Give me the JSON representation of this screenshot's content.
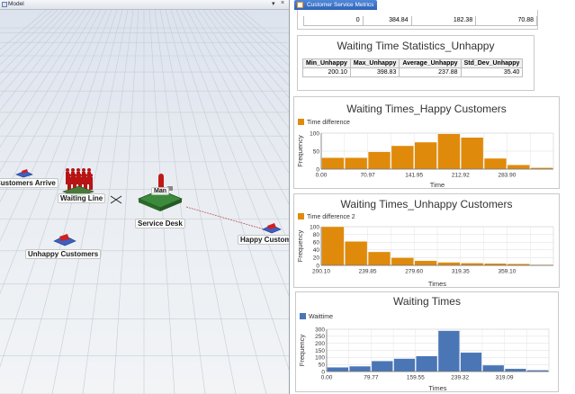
{
  "model_tab": {
    "label": "Model",
    "pin": "▾",
    "close": "×"
  },
  "model_objects": {
    "customers_arrive": "Customers Arrive",
    "waiting_line": "Waiting Line",
    "service_desk": "Service Desk",
    "happy_customers": "Happy Customers",
    "unhappy_customers": "Unhappy Customers",
    "man_label": "Man"
  },
  "metrics_tab": {
    "label": "Customer Service Metrics"
  },
  "top_partial_row": [
    "0",
    "384.84",
    "182.38",
    "70.88"
  ],
  "unhappy_stats": {
    "title": "Waiting Time Statistics_Unhappy",
    "headers": [
      "Min_Unhappy",
      "Max_Unhappy",
      "Average_Unhappy",
      "Std_Dev_Unhappy"
    ],
    "values": [
      "200.10",
      "398.83",
      "237.88",
      "35.40"
    ]
  },
  "chart_data": [
    {
      "type": "bar",
      "title": "Waiting Times_Happy Customers",
      "xlabel": "Time",
      "ylabel": "Frequency",
      "legend": "Time difference",
      "color": "#e08a0c",
      "ylim": [
        0,
        100
      ],
      "yticks": [
        0,
        50,
        100
      ],
      "x_tick_labels": [
        "0.00",
        "70.97",
        "141.95",
        "212.92",
        "283.90"
      ],
      "values": [
        32,
        32,
        48,
        65,
        75,
        98,
        88,
        30,
        12,
        4
      ]
    },
    {
      "type": "bar",
      "title": "Waiting Times_Unhappy Customers",
      "xlabel": "Times",
      "ylabel": "Frequency",
      "legend": "Time difference 2",
      "color": "#e08a0c",
      "ylim": [
        0,
        100
      ],
      "yticks": [
        0,
        20,
        40,
        60,
        80,
        100
      ],
      "x_tick_labels": [
        "200.10",
        "239.85",
        "279.60",
        "319.35",
        "359.10"
      ],
      "values": [
        100,
        62,
        35,
        20,
        12,
        8,
        6,
        5,
        4,
        2
      ]
    },
    {
      "type": "bar",
      "title": "Waiting Times",
      "xlabel": "Times",
      "ylabel": "Frequency",
      "legend": "Waittime",
      "color": "#4a76b6",
      "ylim": [
        0,
        300
      ],
      "yticks": [
        0,
        50,
        100,
        150,
        200,
        250,
        300
      ],
      "x_tick_labels": [
        "0.00",
        "79.77",
        "159.55",
        "239.32",
        "319.09"
      ],
      "values": [
        30,
        38,
        75,
        92,
        110,
        290,
        135,
        45,
        20,
        10
      ]
    }
  ]
}
